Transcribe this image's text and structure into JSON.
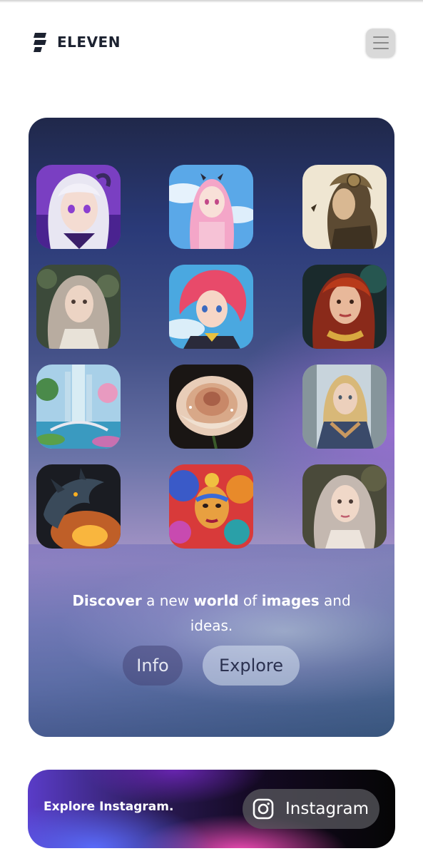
{
  "header": {
    "brand": "ELEVEN"
  },
  "hero": {
    "tagline": {
      "w1": "Discover",
      "t1": " a new ",
      "w2": "world",
      "t2": " of ",
      "w3": "images",
      "t3": " and ideas."
    },
    "info_label": "Info",
    "explore_label": "Explore"
  },
  "gallery": [
    "anime-girl-white-hair",
    "anime-girl-pink-hair",
    "steampunk-woman",
    "woman-long-grey-hair",
    "anime-girl-red-hair",
    "woman-gold-jewelry",
    "fantasy-city-garden",
    "rose-with-dew",
    "warrior-woman-braids",
    "fire-dragon",
    "colorful-face-art",
    "girl-long-hair"
  ],
  "instagram": {
    "promo_text": "Explore Instagram.",
    "button_label": "Instagram"
  },
  "colors": {
    "brand_text": "#1c2230",
    "hero_top": "#20284a",
    "ig_accent_blue": "#5a6eff",
    "ig_accent_pink": "#ff50be"
  }
}
